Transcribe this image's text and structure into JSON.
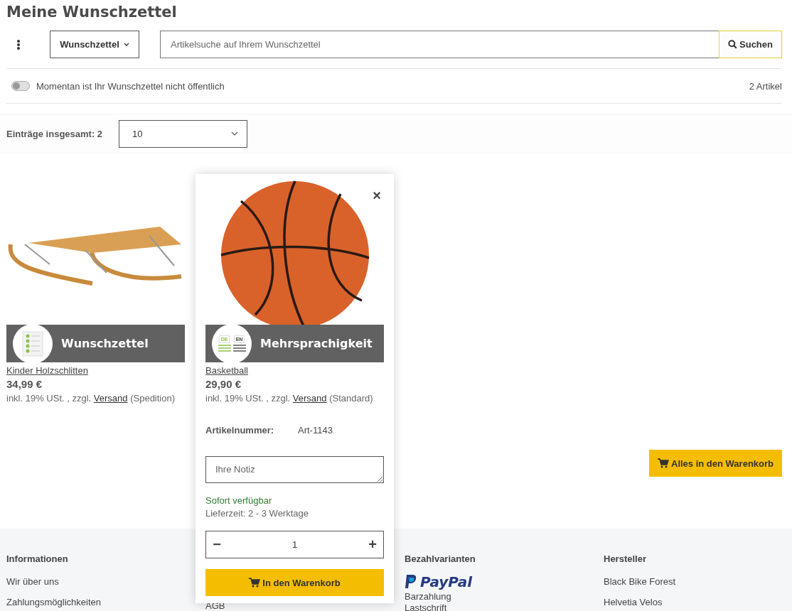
{
  "page_title": "Meine Wunschzettel",
  "toolbar": {
    "list_select": "Wunschzettel",
    "search": {
      "placeholder": "Artikelsuche auf Ihrem Wunschzettel"
    },
    "search_button": "Suchen"
  },
  "visibility": {
    "public": false,
    "label": "Momentan ist Ihr Wunschzettel nicht öffentlich",
    "count": "2 Artikel"
  },
  "entries": {
    "label": "Einträge insgesamt: 2",
    "per_page": "10"
  },
  "products": [
    {
      "banner": {
        "kind": "checklist",
        "text": "Wunschzettel"
      },
      "name": "Kinder Holzschlitten",
      "price": "34,99 €",
      "tax": "inkl. 19% USt. , zzgl.",
      "shipping_link": "Versand",
      "shipping_type": "(Spedition)",
      "hovered": false
    },
    {
      "banner": {
        "kind": "languages",
        "text": "Mehrsprachigkeit",
        "lang_1": "DE",
        "lang_2": "EN"
      },
      "name": "Basketball",
      "price": "29,90 €",
      "tax": "inkl. 19% USt. , zzgl.",
      "shipping_link": "Versand",
      "shipping_type": "(Standard)",
      "hovered": true,
      "close": "×",
      "sku_label": "Artikelnummer:",
      "sku": "Art-1143",
      "note": {
        "placeholder": "Ihre Notiz"
      },
      "availability": "Sofort verfügbar",
      "delivery": "Lieferzeit: 2 - 3 Werktage",
      "qty_minus": "−",
      "qty": "1",
      "qty_plus": "+",
      "cart_button": "In den Warenkorb"
    }
  ],
  "all_to_cart": "Alles in den Warenkorb",
  "footer": {
    "columns": [
      {
        "heading": "Informationen",
        "items": [
          {
            "kind": "link",
            "text": "Wir über uns"
          },
          {
            "kind": "link",
            "text": "Zahlungsmöglichkeiten"
          }
        ]
      },
      {
        "items": [
          {
            "kind": "link",
            "text": "AGB"
          }
        ]
      },
      {
        "heading": "Bezahlvarianten",
        "items": [
          {
            "kind": "logo",
            "text": "PayPal"
          },
          {
            "kind": "text",
            "text": "Barzahlung"
          },
          {
            "kind": "text",
            "text": "Lastschrift"
          }
        ]
      },
      {
        "heading": "Hersteller",
        "items": [
          {
            "kind": "link",
            "text": "Black Bike Forest"
          },
          {
            "kind": "link",
            "text": "Helvetia Velos"
          }
        ]
      }
    ]
  }
}
